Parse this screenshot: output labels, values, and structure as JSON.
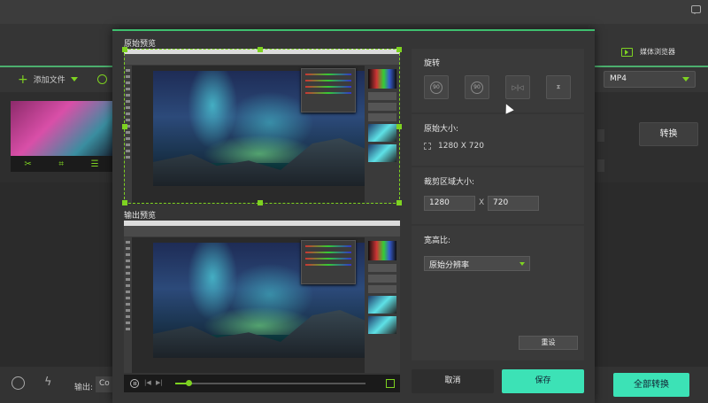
{
  "app": {
    "media_browser_label": "媒体浏览器",
    "add_file_label": "添加文件",
    "format_value": "MP4",
    "convert_label": "转换",
    "output_label": "输出:",
    "output_value": "Co",
    "convert_all_label": "全部转换"
  },
  "dialog": {
    "original_preview_label": "原始预览",
    "output_preview_label": "输出预览",
    "rotate": {
      "title": "旋转",
      "buttons": [
        {
          "icon": "rotate-left-90-icon",
          "text": "90"
        },
        {
          "icon": "rotate-right-90-icon",
          "text": "90"
        },
        {
          "icon": "flip-horizontal-icon",
          "text": ""
        },
        {
          "icon": "flip-vertical-icon",
          "text": ""
        }
      ]
    },
    "original_size": {
      "title": "原始大小:",
      "value": "1280 X 720"
    },
    "crop_size": {
      "title": "裁剪区域大小:",
      "width": "1280",
      "separator": "X",
      "height": "720"
    },
    "aspect_ratio": {
      "title": "宽高比:",
      "selected": "原始分辨率"
    },
    "reset_label": "重设",
    "cancel_label": "取消",
    "save_label": "保存",
    "playback_progress": 0.07
  },
  "colors": {
    "accent_green": "#7ed321",
    "save_teal": "#3ce2b6"
  }
}
